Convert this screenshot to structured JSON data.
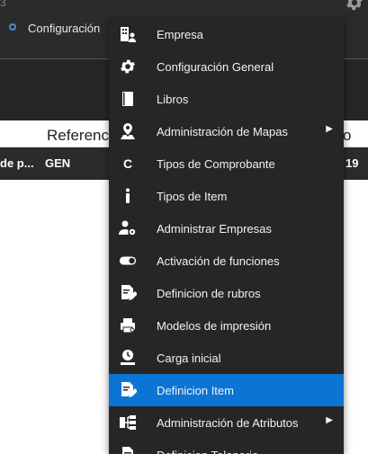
{
  "window": {
    "corner_number": "3",
    "breadcrumb_label": "Configuración"
  },
  "table": {
    "header_left": "Referenc",
    "header_right": "o",
    "row": [
      "de p...",
      "GEN",
      "19"
    ]
  },
  "menu": {
    "items": [
      {
        "label": "Empresa",
        "icon": "building-user-icon",
        "submenu": false,
        "active": false
      },
      {
        "label": "Configuración General",
        "icon": "gear-icon",
        "submenu": false,
        "active": false
      },
      {
        "label": "Libros",
        "icon": "book-icon",
        "submenu": false,
        "active": false
      },
      {
        "label": "Administración de Mapas",
        "icon": "map-pin-icon",
        "submenu": true,
        "active": false
      },
      {
        "label": "Tipos de Comprobante",
        "icon": "letter-c-icon",
        "submenu": false,
        "active": false
      },
      {
        "label": "Tipos de Item",
        "icon": "info-icon",
        "submenu": false,
        "active": false
      },
      {
        "label": "Administrar Empresas",
        "icon": "user-gear-icon",
        "submenu": false,
        "active": false
      },
      {
        "label": "Activación de funciones",
        "icon": "toggle-icon",
        "submenu": false,
        "active": false
      },
      {
        "label": "Definicion de rubros",
        "icon": "doc-edit-icon",
        "submenu": false,
        "active": false
      },
      {
        "label": "Modelos de impresión",
        "icon": "printer-gear-icon",
        "submenu": false,
        "active": false
      },
      {
        "label": "Carga inicial",
        "icon": "clock-upload-icon",
        "submenu": false,
        "active": false
      },
      {
        "label": "Definicion Item",
        "icon": "doc-edit-icon",
        "submenu": false,
        "active": true
      },
      {
        "label": "Administración de Atributos",
        "icon": "hierarchy-icon",
        "submenu": true,
        "active": false
      },
      {
        "label": "Definicion Talonario",
        "icon": "doc-icon",
        "submenu": false,
        "active": false
      }
    ]
  },
  "colors": {
    "menu_bg": "#262626",
    "active_bg": "#0b74d4",
    "topbar_bg": "#2b2b2b"
  }
}
